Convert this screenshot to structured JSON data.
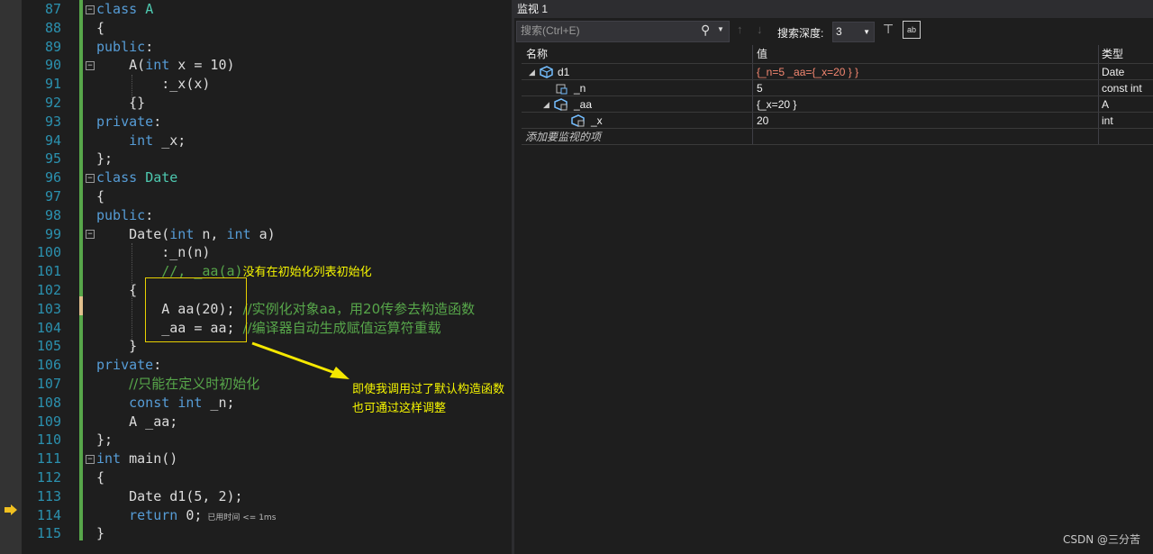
{
  "editor": {
    "line_numbers": [
      "87",
      "88",
      "89",
      "90",
      "91",
      "92",
      "93",
      "94",
      "95",
      "96",
      "97",
      "98",
      "99",
      "100",
      "101",
      "102",
      "103",
      "104",
      "105",
      "106",
      "107",
      "108",
      "109",
      "110",
      "111",
      "112",
      "113",
      "114",
      "115"
    ],
    "elapsed": "已用时间 <= 1ms",
    "callout_line1": "即使我调用过了默认构造函数",
    "callout_line2": "也可通过这样调整",
    "ann_101": "没有在初始化列表初始化",
    "ann_103": "//实例化对象aa，用20传参去构造函数",
    "ann_104": "//编译器自动生成赋值运算符重载",
    "ann_107": "//只能在定义时初始化"
  },
  "watch": {
    "title": "监视 1",
    "search_placeholder": "搜索(Ctrl+E)",
    "depth_label": "搜索深度:",
    "depth_value": "3",
    "columns": {
      "name": "名称",
      "value": "值",
      "type": "类型"
    },
    "rows": [
      {
        "name": "d1",
        "value": "{_n=5 _aa={_x=20 } }",
        "type": "Date"
      },
      {
        "name": "_n",
        "value": "5",
        "type": "const int"
      },
      {
        "name": "_aa",
        "value": "{_x=20 }",
        "type": "A"
      },
      {
        "name": "_x",
        "value": "20",
        "type": "int"
      }
    ],
    "add_item": "添加要监视的项"
  },
  "watermark": "CSDN @三分苦"
}
